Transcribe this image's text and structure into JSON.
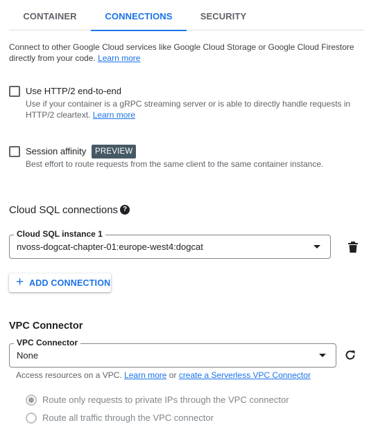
{
  "tabs": [
    {
      "label": "CONTAINER",
      "active": false
    },
    {
      "label": "CONNECTIONS",
      "active": true
    },
    {
      "label": "SECURITY",
      "active": false
    }
  ],
  "intro": {
    "text": "Connect to other Google Cloud services like Google Cloud Storage or Google Cloud Firestore directly from your code.",
    "link": "Learn more"
  },
  "http2": {
    "label": "Use HTTP/2 end-to-end",
    "checked": false,
    "help": "Use if your container is a gRPC streaming server or is able to directly handle requests in HTTP/2 cleartext.",
    "link": "Learn more"
  },
  "session_affinity": {
    "label": "Session affinity",
    "checked": false,
    "badge": "PREVIEW",
    "help": "Best effort to route requests from the same client to the same container instance."
  },
  "cloud_sql": {
    "title": "Cloud SQL connections",
    "help_icon": "help-circle-icon",
    "instance_label": "Cloud SQL instance 1",
    "instance_value": "nvoss-dogcat-chapter-01:europe-west4:dogcat",
    "delete_icon": "trash-icon",
    "add_label": "ADD CONNECTION"
  },
  "vpc": {
    "title": "VPC Connector",
    "field_label": "VPC Connector",
    "value": "None",
    "refresh_icon": "refresh-icon",
    "help_prefix": "Access resources on a VPC.",
    "learn_more": "Learn more",
    "or": "or",
    "create_link": "create a Serverless VPC Connector",
    "options": [
      {
        "label": "Route only requests to private IPs through the VPC connector",
        "checked": true,
        "disabled": true
      },
      {
        "label": "Route all traffic through the VPC connector",
        "checked": false,
        "disabled": true
      }
    ]
  },
  "colors": {
    "accent": "#1a73e8",
    "badge_bg": "#455a64",
    "text": "#202124",
    "muted": "#5f6368"
  }
}
